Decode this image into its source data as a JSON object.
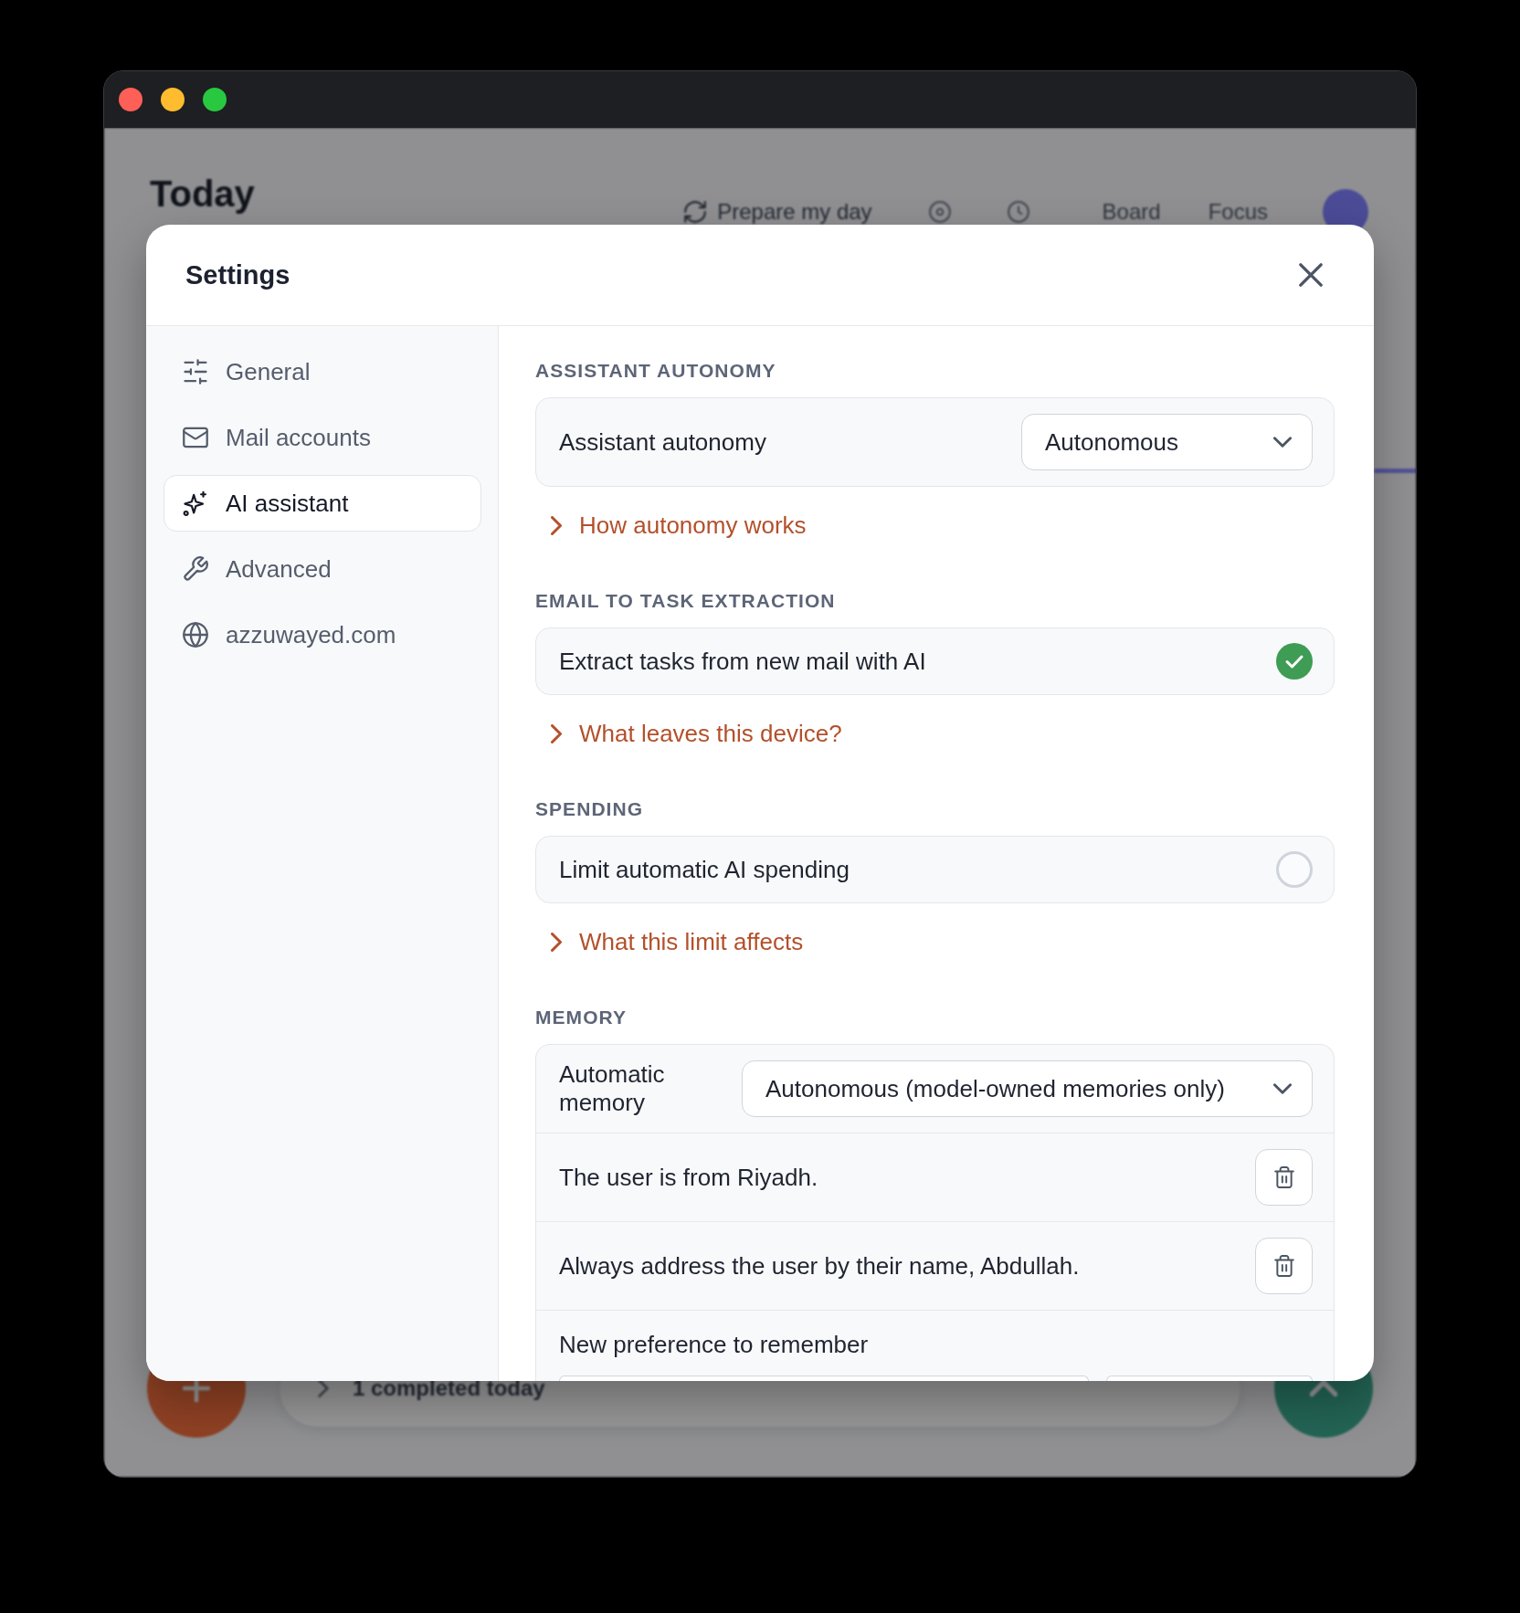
{
  "background_app": {
    "title": "Today",
    "toolbar": {
      "action": "Prepare my day",
      "views": [
        "Board",
        "Focus"
      ]
    },
    "summary": "1 completed today"
  },
  "settings_dialog": {
    "title": "Settings",
    "sidebar": {
      "items": [
        {
          "label": "General",
          "selected": false
        },
        {
          "label": "Mail accounts",
          "selected": false
        },
        {
          "label": "AI assistant",
          "selected": true
        },
        {
          "label": "Advanced",
          "selected": false
        },
        {
          "label": "azzuwayed.com",
          "selected": false
        }
      ]
    },
    "sections": [
      {
        "heading": "ASSISTANT AUTONOMY",
        "rows": [
          {
            "kind": "select",
            "label": "Assistant autonomy",
            "value": "Autonomous"
          }
        ],
        "link": {
          "label": "How autonomy works",
          "expanded": false
        }
      },
      {
        "heading": "EMAIL TO TASK EXTRACTION",
        "rows": [
          {
            "kind": "checkbox",
            "label": "Extract tasks from new mail with AI",
            "checked": true
          }
        ],
        "link": {
          "label": "What leaves this device?",
          "expanded": false
        }
      },
      {
        "heading": "SPENDING",
        "rows": [
          {
            "kind": "checkbox",
            "label": "Limit automatic AI spending",
            "checked": false
          }
        ],
        "link": {
          "label": "What this limit affects",
          "expanded": false
        }
      },
      {
        "heading": "MEMORY",
        "rows": [
          {
            "kind": "select",
            "label": "Automatic memory",
            "value": "Autonomous (model-owned memories only)"
          },
          {
            "kind": "memory",
            "text": "The user is from Riyadh."
          },
          {
            "kind": "memory",
            "text": "Always address the user by their name, Abdullah."
          },
          {
            "kind": "new_entry",
            "label": "New preference to remember"
          }
        ]
      }
    ]
  }
}
